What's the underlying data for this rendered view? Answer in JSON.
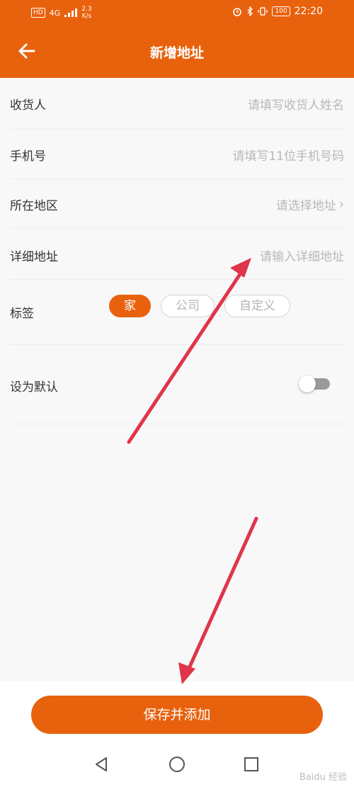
{
  "status_bar": {
    "hd": "HD",
    "network": "4G",
    "speed_top": "2.3",
    "speed_unit": "K/s",
    "battery": "100",
    "time": "22:20"
  },
  "header": {
    "title": "新增地址"
  },
  "form": {
    "recipient": {
      "label": "收货人",
      "placeholder": "请填写收货人姓名"
    },
    "phone": {
      "label": "手机号",
      "placeholder": "请填写11位手机号码"
    },
    "region": {
      "label": "所在地区",
      "placeholder": "请选择地址"
    },
    "detail": {
      "label": "详细地址",
      "placeholder": "请输入详细地址"
    },
    "tags": {
      "label": "标签",
      "options": [
        "家",
        "公司",
        "自定义"
      ],
      "selected": "家"
    },
    "default": {
      "label": "设为默认",
      "enabled": false
    }
  },
  "footer": {
    "save_label": "保存并添加"
  },
  "watermark": "Baidu 经验",
  "colors": {
    "accent": "#e8620e",
    "annotation_arrow": "#e0354a"
  }
}
